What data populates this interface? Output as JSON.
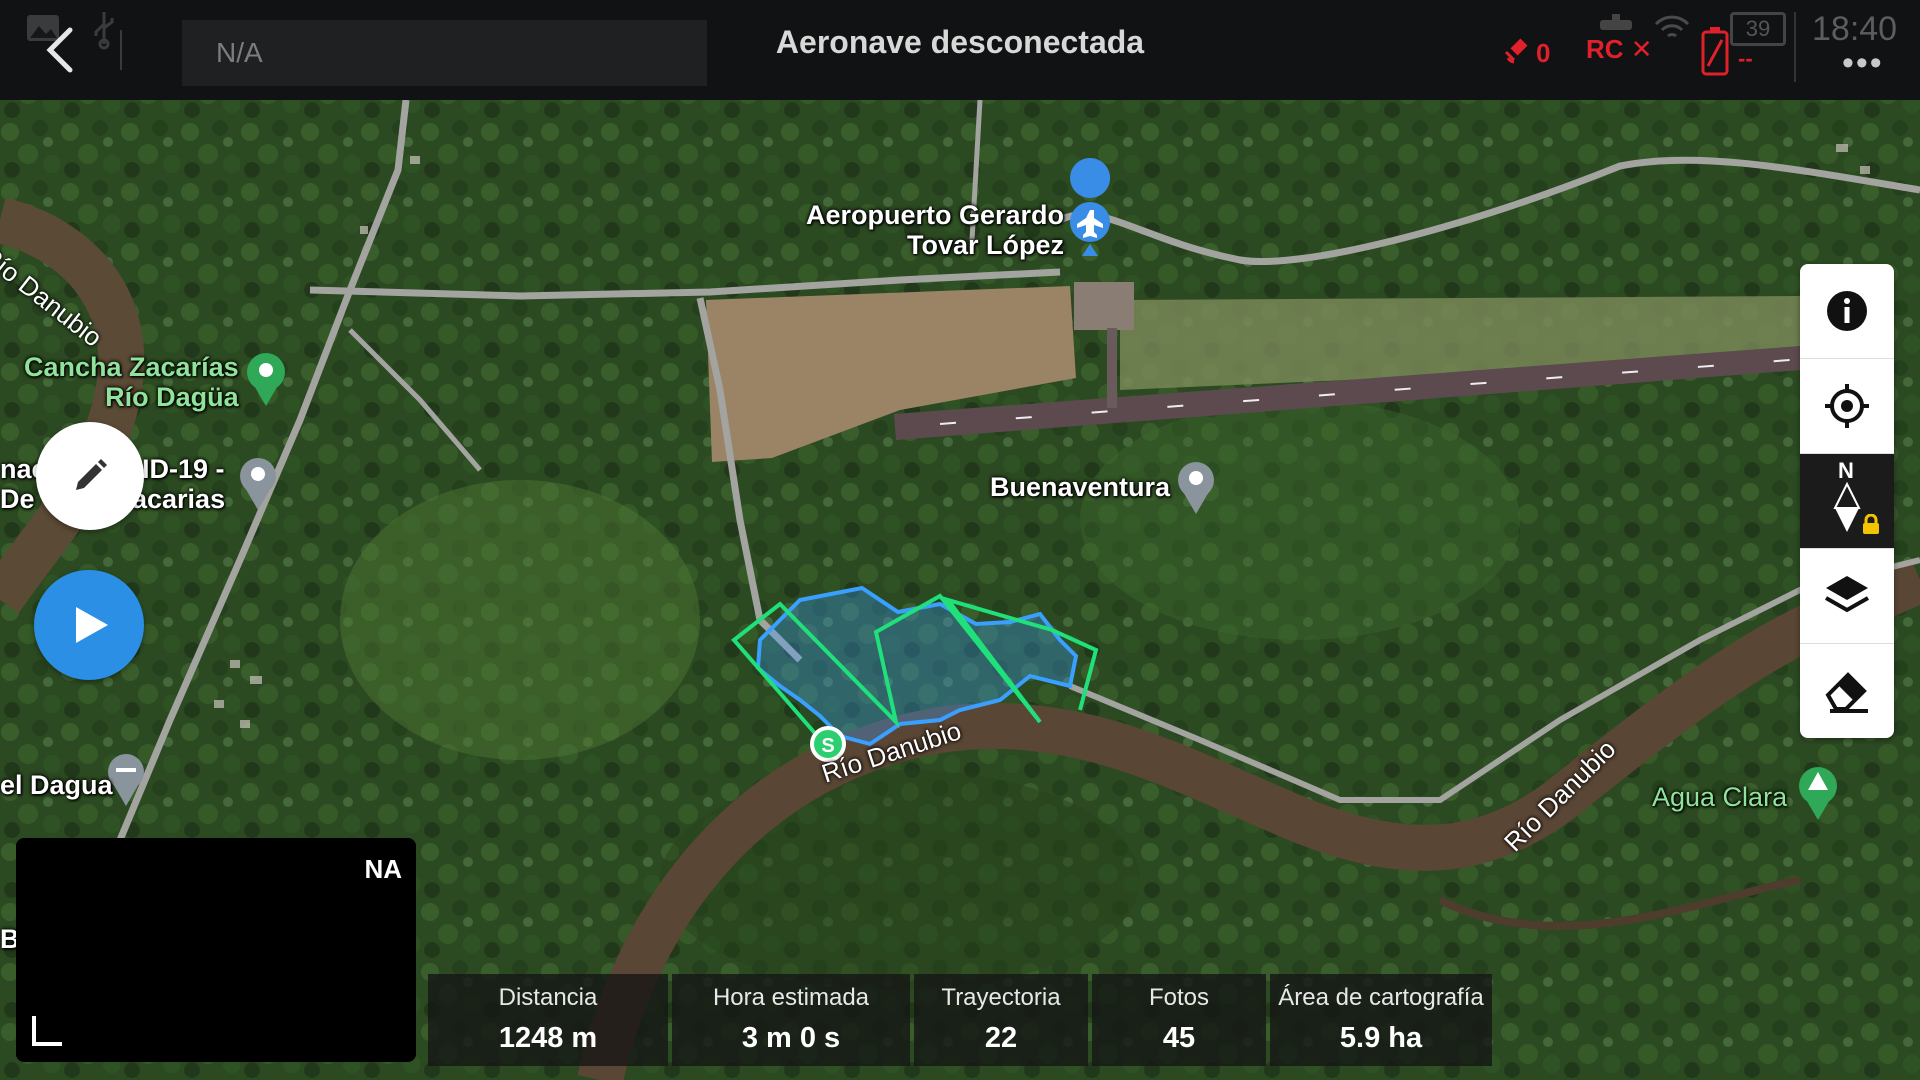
{
  "topbar": {
    "mission_name": "N/A",
    "connection_status": "Aeronave desconectada",
    "satellite_count": "0",
    "rc_label": "RC",
    "battery_level": "--",
    "battery_pct": "39",
    "time": "18:40",
    "more_label": "•••"
  },
  "map": {
    "places": {
      "airport": [
        "Aeropuerto Gerardo",
        "Tovar López"
      ],
      "cancha": [
        "Cancha Zacarías",
        "Río Dagüa"
      ],
      "covid": [
        "nac",
        "ID-19 -",
        "De",
        "acarias"
      ],
      "buenaventura": "Buenaventura",
      "agua_clara": "Agua Clara",
      "dagua": "el Dagua",
      "rio_danubio_top": "Río Danubio",
      "rio_danubio_center": "Río Danubio",
      "rio_danubio_right": "Río Danubio",
      "edge_b": "B"
    },
    "start_marker_label": "S",
    "compass_label": "N"
  },
  "colors": {
    "flight_path": "#1fe07a",
    "survey_area": "#3aa0ff",
    "accent_blue": "#2b8fe6",
    "alert_red": "#e0202a"
  },
  "icons": [
    "back-icon",
    "image-icon",
    "usb-icon",
    "satellite-icon",
    "battery-icon",
    "wifi-icon",
    "more-icon",
    "edit-icon",
    "play-icon",
    "info-icon",
    "locate-icon",
    "compass-icon",
    "layers-icon",
    "eraser-icon",
    "airport-pin-icon",
    "place-pin-icon",
    "park-pin-icon",
    "bridge-pin-icon"
  ],
  "minimap": {
    "label": "NA"
  },
  "stats": [
    {
      "label": "Distancia",
      "value": "1248 m"
    },
    {
      "label": "Hora estimada",
      "value": "3 m 0 s"
    },
    {
      "label": "Trayectoria",
      "value": "22"
    },
    {
      "label": "Fotos",
      "value": "45"
    },
    {
      "label": "Área de cartografía",
      "value": "5.9 ha"
    }
  ]
}
